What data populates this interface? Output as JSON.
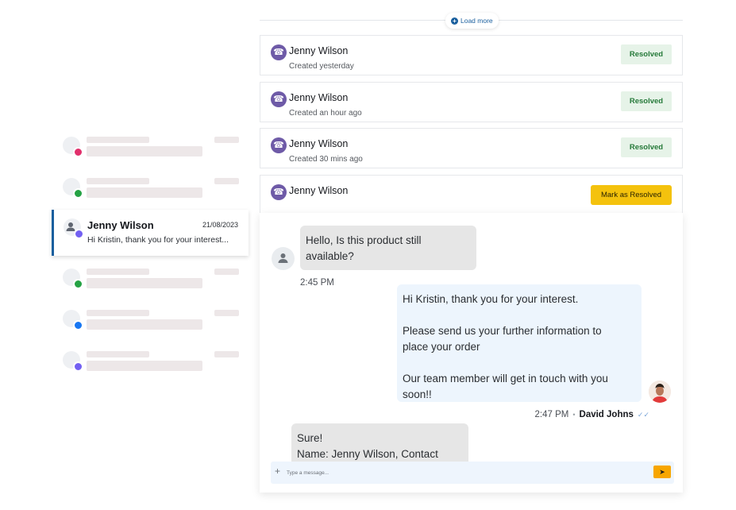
{
  "left_list": {
    "placeholder_items": [
      {
        "channel": "instagram",
        "icon": "instagram-icon"
      },
      {
        "channel": "whatsapp",
        "icon": "whatsapp-icon"
      },
      {
        "channel": "whatsapp",
        "icon": "whatsapp-icon"
      },
      {
        "channel": "facebook",
        "icon": "facebook-icon"
      },
      {
        "channel": "viber",
        "icon": "viber-icon"
      }
    ],
    "active": {
      "name": "Jenny Wilson",
      "date": "21/08/2023",
      "preview": "Hi Kristin, thank you for your interest..."
    }
  },
  "load_more": {
    "label": "Load more"
  },
  "tickets": [
    {
      "name": "Jenny Wilson",
      "subtitle": "Created yesterday",
      "status": "Resolved"
    },
    {
      "name": "Jenny Wilson",
      "subtitle": "Created an hour ago",
      "status": "Resolved"
    },
    {
      "name": "Jenny Wilson",
      "subtitle": "Created 30 mins ago",
      "status": "Resolved"
    },
    {
      "name": "Jenny Wilson",
      "action": "Mark as Resolved"
    }
  ],
  "chat": {
    "messages": [
      {
        "direction": "in",
        "lines": [
          "Hello, Is this product still",
          "available?"
        ],
        "time": "2:45 PM"
      },
      {
        "direction": "out",
        "paragraphs": [
          [
            "Hi Kristin, thank you for your interest."
          ],
          [
            "Please send us your further information to",
            "place your order"
          ],
          [
            "Our team member will get in touch with you",
            "soon!!"
          ]
        ],
        "time": "2:47 PM",
        "agent": "David Johns"
      },
      {
        "direction": "in",
        "lines": [
          "Sure!",
          "Name: Jenny Wilson, Contact"
        ]
      }
    ],
    "composer": {
      "placeholder": "Type a message..."
    }
  },
  "colors": {
    "accent": "#1a5f9e",
    "resolved_bg": "#e6f3e8",
    "resolved_text": "#267a3a",
    "mark_button": "#f4c20d",
    "send_button": "#f7a600",
    "viber": "#6e5aa7"
  }
}
